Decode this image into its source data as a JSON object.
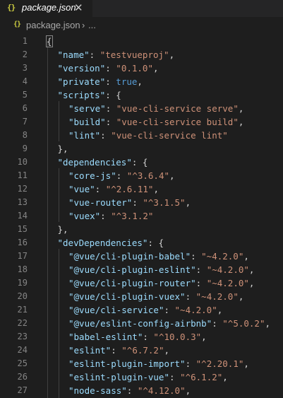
{
  "tab": {
    "icon_text": "{}",
    "label": "package.json",
    "close_glyph": "✕"
  },
  "breadcrumb": {
    "icon_text": "{}",
    "file": "package.json",
    "separator": "›",
    "more": "..."
  },
  "colors": {
    "key": "#9cdcfe",
    "string": "#ce9178",
    "keyword": "#569cd6",
    "punctuation": "#d4d4d4",
    "line_number": "#858585",
    "json_icon": "#cbcb41"
  },
  "lines": [
    {
      "n": "1",
      "indent": 0,
      "tokens": [
        {
          "t": "brace-hl",
          "v": "{"
        }
      ]
    },
    {
      "n": "2",
      "indent": 1,
      "tokens": [
        {
          "t": "key",
          "v": "\"name\""
        },
        {
          "t": "p",
          "v": ": "
        },
        {
          "t": "str",
          "v": "\"testvueproj\""
        },
        {
          "t": "p",
          "v": ","
        }
      ]
    },
    {
      "n": "3",
      "indent": 1,
      "tokens": [
        {
          "t": "key",
          "v": "\"version\""
        },
        {
          "t": "p",
          "v": ": "
        },
        {
          "t": "str",
          "v": "\"0.1.0\""
        },
        {
          "t": "p",
          "v": ","
        }
      ]
    },
    {
      "n": "4",
      "indent": 1,
      "tokens": [
        {
          "t": "key",
          "v": "\"private\""
        },
        {
          "t": "p",
          "v": ": "
        },
        {
          "t": "kw",
          "v": "true"
        },
        {
          "t": "p",
          "v": ","
        }
      ]
    },
    {
      "n": "5",
      "indent": 1,
      "tokens": [
        {
          "t": "key",
          "v": "\"scripts\""
        },
        {
          "t": "p",
          "v": ": {"
        }
      ]
    },
    {
      "n": "6",
      "indent": 2,
      "tokens": [
        {
          "t": "key",
          "v": "\"serve\""
        },
        {
          "t": "p",
          "v": ": "
        },
        {
          "t": "str",
          "v": "\"vue-cli-service serve\""
        },
        {
          "t": "p",
          "v": ","
        }
      ]
    },
    {
      "n": "7",
      "indent": 2,
      "tokens": [
        {
          "t": "key",
          "v": "\"build\""
        },
        {
          "t": "p",
          "v": ": "
        },
        {
          "t": "str",
          "v": "\"vue-cli-service build\""
        },
        {
          "t": "p",
          "v": ","
        }
      ]
    },
    {
      "n": "8",
      "indent": 2,
      "tokens": [
        {
          "t": "key",
          "v": "\"lint\""
        },
        {
          "t": "p",
          "v": ": "
        },
        {
          "t": "str",
          "v": "\"vue-cli-service lint\""
        }
      ]
    },
    {
      "n": "9",
      "indent": 1,
      "tokens": [
        {
          "t": "p",
          "v": "},"
        }
      ]
    },
    {
      "n": "10",
      "indent": 1,
      "tokens": [
        {
          "t": "key",
          "v": "\"dependencies\""
        },
        {
          "t": "p",
          "v": ": {"
        }
      ]
    },
    {
      "n": "11",
      "indent": 2,
      "tokens": [
        {
          "t": "key",
          "v": "\"core-js\""
        },
        {
          "t": "p",
          "v": ": "
        },
        {
          "t": "str",
          "v": "\"^3.6.4\""
        },
        {
          "t": "p",
          "v": ","
        }
      ]
    },
    {
      "n": "12",
      "indent": 2,
      "tokens": [
        {
          "t": "key",
          "v": "\"vue\""
        },
        {
          "t": "p",
          "v": ": "
        },
        {
          "t": "str",
          "v": "\"^2.6.11\""
        },
        {
          "t": "p",
          "v": ","
        }
      ]
    },
    {
      "n": "13",
      "indent": 2,
      "tokens": [
        {
          "t": "key",
          "v": "\"vue-router\""
        },
        {
          "t": "p",
          "v": ": "
        },
        {
          "t": "str",
          "v": "\"^3.1.5\""
        },
        {
          "t": "p",
          "v": ","
        }
      ]
    },
    {
      "n": "14",
      "indent": 2,
      "tokens": [
        {
          "t": "key",
          "v": "\"vuex\""
        },
        {
          "t": "p",
          "v": ": "
        },
        {
          "t": "str",
          "v": "\"^3.1.2\""
        }
      ]
    },
    {
      "n": "15",
      "indent": 1,
      "tokens": [
        {
          "t": "p",
          "v": "},"
        }
      ]
    },
    {
      "n": "16",
      "indent": 1,
      "tokens": [
        {
          "t": "key",
          "v": "\"devDependencies\""
        },
        {
          "t": "p",
          "v": ": {"
        }
      ]
    },
    {
      "n": "17",
      "indent": 2,
      "tokens": [
        {
          "t": "key",
          "v": "\"@vue/cli-plugin-babel\""
        },
        {
          "t": "p",
          "v": ": "
        },
        {
          "t": "str",
          "v": "\"~4.2.0\""
        },
        {
          "t": "p",
          "v": ","
        }
      ]
    },
    {
      "n": "18",
      "indent": 2,
      "tokens": [
        {
          "t": "key",
          "v": "\"@vue/cli-plugin-eslint\""
        },
        {
          "t": "p",
          "v": ": "
        },
        {
          "t": "str",
          "v": "\"~4.2.0\""
        },
        {
          "t": "p",
          "v": ","
        }
      ]
    },
    {
      "n": "19",
      "indent": 2,
      "tokens": [
        {
          "t": "key",
          "v": "\"@vue/cli-plugin-router\""
        },
        {
          "t": "p",
          "v": ": "
        },
        {
          "t": "str",
          "v": "\"~4.2.0\""
        },
        {
          "t": "p",
          "v": ","
        }
      ]
    },
    {
      "n": "20",
      "indent": 2,
      "tokens": [
        {
          "t": "key",
          "v": "\"@vue/cli-plugin-vuex\""
        },
        {
          "t": "p",
          "v": ": "
        },
        {
          "t": "str",
          "v": "\"~4.2.0\""
        },
        {
          "t": "p",
          "v": ","
        }
      ]
    },
    {
      "n": "21",
      "indent": 2,
      "tokens": [
        {
          "t": "key",
          "v": "\"@vue/cli-service\""
        },
        {
          "t": "p",
          "v": ": "
        },
        {
          "t": "str",
          "v": "\"~4.2.0\""
        },
        {
          "t": "p",
          "v": ","
        }
      ]
    },
    {
      "n": "22",
      "indent": 2,
      "tokens": [
        {
          "t": "key",
          "v": "\"@vue/eslint-config-airbnb\""
        },
        {
          "t": "p",
          "v": ": "
        },
        {
          "t": "str",
          "v": "\"^5.0.2\""
        },
        {
          "t": "p",
          "v": ","
        }
      ]
    },
    {
      "n": "23",
      "indent": 2,
      "tokens": [
        {
          "t": "key",
          "v": "\"babel-eslint\""
        },
        {
          "t": "p",
          "v": ": "
        },
        {
          "t": "str",
          "v": "\"^10.0.3\""
        },
        {
          "t": "p",
          "v": ","
        }
      ]
    },
    {
      "n": "24",
      "indent": 2,
      "tokens": [
        {
          "t": "key",
          "v": "\"eslint\""
        },
        {
          "t": "p",
          "v": ": "
        },
        {
          "t": "str",
          "v": "\"^6.7.2\""
        },
        {
          "t": "p",
          "v": ","
        }
      ]
    },
    {
      "n": "25",
      "indent": 2,
      "tokens": [
        {
          "t": "key",
          "v": "\"eslint-plugin-import\""
        },
        {
          "t": "p",
          "v": ": "
        },
        {
          "t": "str",
          "v": "\"^2.20.1\""
        },
        {
          "t": "p",
          "v": ","
        }
      ]
    },
    {
      "n": "26",
      "indent": 2,
      "tokens": [
        {
          "t": "key",
          "v": "\"eslint-plugin-vue\""
        },
        {
          "t": "p",
          "v": ": "
        },
        {
          "t": "str",
          "v": "\"^6.1.2\""
        },
        {
          "t": "p",
          "v": ","
        }
      ]
    },
    {
      "n": "27",
      "indent": 2,
      "tokens": [
        {
          "t": "key",
          "v": "\"node-sass\""
        },
        {
          "t": "p",
          "v": ": "
        },
        {
          "t": "str",
          "v": "\"^4.12.0\""
        },
        {
          "t": "p",
          "v": ","
        }
      ]
    }
  ]
}
